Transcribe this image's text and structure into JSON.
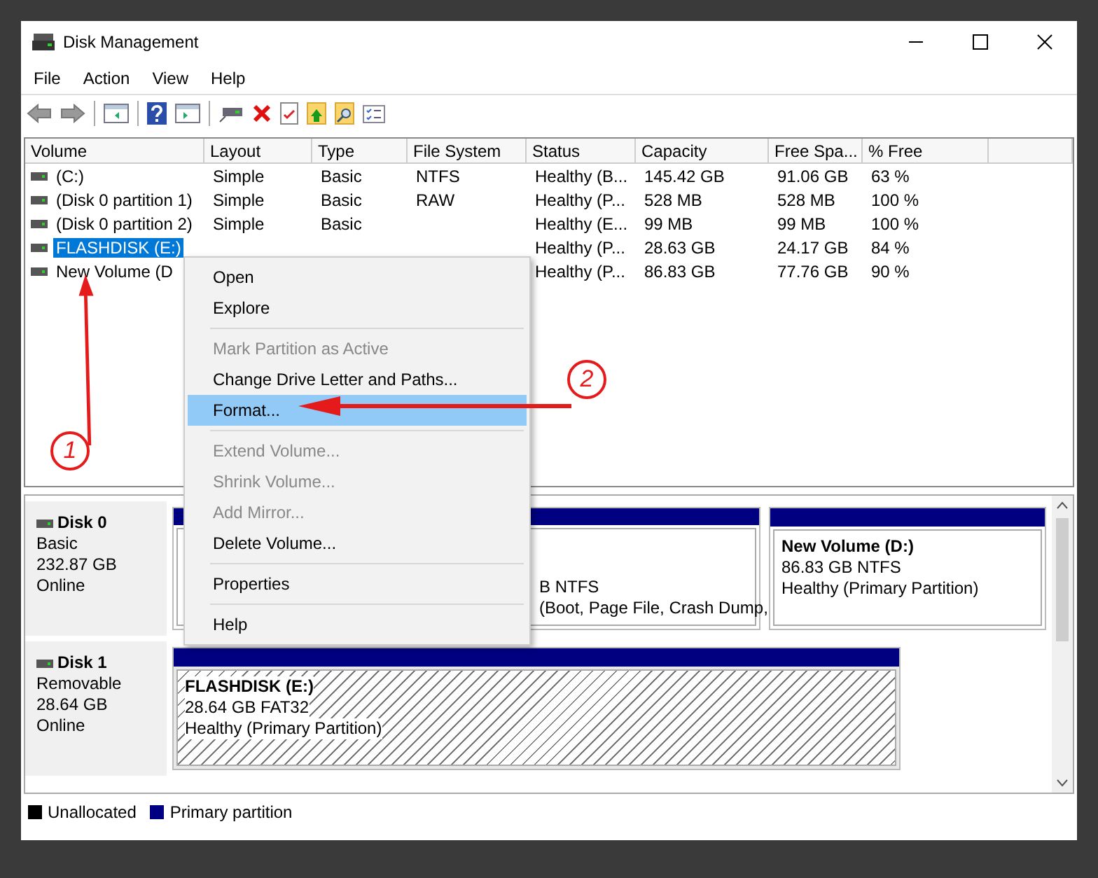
{
  "window": {
    "title": "Disk Management"
  },
  "menu_bar": [
    "File",
    "Action",
    "View",
    "Help"
  ],
  "table": {
    "columns": [
      "Volume",
      "Layout",
      "Type",
      "File System",
      "Status",
      "Capacity",
      "Free Spa...",
      "% Free"
    ],
    "rows": [
      {
        "selected": false,
        "cells": [
          "(C:)",
          "Simple",
          "Basic",
          "NTFS",
          "Healthy (B...",
          "145.42 GB",
          "91.06 GB",
          "63 %"
        ]
      },
      {
        "selected": false,
        "cells": [
          "(Disk 0 partition 1)",
          "Simple",
          "Basic",
          "RAW",
          "Healthy (P...",
          "528 MB",
          "528 MB",
          "100 %"
        ]
      },
      {
        "selected": false,
        "cells": [
          "(Disk 0 partition 2)",
          "Simple",
          "Basic",
          "",
          "Healthy (E...",
          "99 MB",
          "99 MB",
          "100 %"
        ]
      },
      {
        "selected": true,
        "cells": [
          "FLASHDISK (E:)",
          "",
          "",
          "",
          "Healthy (P...",
          "28.63 GB",
          "24.17 GB",
          "84 %"
        ]
      },
      {
        "selected": false,
        "cells": [
          "New Volume (D",
          "",
          "",
          "",
          "Healthy (P...",
          "86.83 GB",
          "77.76 GB",
          "90 %"
        ]
      }
    ]
  },
  "context_menu": {
    "items": [
      {
        "label": "Open",
        "disabled": false,
        "selected": false,
        "separator_after": false
      },
      {
        "label": "Explore",
        "disabled": false,
        "selected": false,
        "separator_after": true
      },
      {
        "label": "Mark Partition as Active",
        "disabled": true,
        "selected": false,
        "separator_after": false
      },
      {
        "label": "Change Drive Letter and Paths...",
        "disabled": false,
        "selected": false,
        "separator_after": false
      },
      {
        "label": "Format...",
        "disabled": false,
        "selected": true,
        "separator_after": true
      },
      {
        "label": "Extend Volume...",
        "disabled": true,
        "selected": false,
        "separator_after": false
      },
      {
        "label": "Shrink Volume...",
        "disabled": true,
        "selected": false,
        "separator_after": false
      },
      {
        "label": "Add Mirror...",
        "disabled": true,
        "selected": false,
        "separator_after": false
      },
      {
        "label": "Delete Volume...",
        "disabled": false,
        "selected": false,
        "separator_after": true
      },
      {
        "label": "Properties",
        "disabled": false,
        "selected": false,
        "separator_after": true
      },
      {
        "label": "Help",
        "disabled": false,
        "selected": false,
        "separator_after": false
      }
    ]
  },
  "disks": [
    {
      "name": "Disk 0",
      "type": "Basic",
      "size": "232.87 GB",
      "status": "Online",
      "partitions": [
        {
          "kind": "hidden",
          "size_fs": "B NTFS",
          "status": "(Boot, Page File, Crash Dump,"
        },
        {
          "kind": "plain",
          "title": "New Volume  (D:)",
          "size_fs": "86.83 GB NTFS",
          "status": "Healthy (Primary Partition)"
        }
      ]
    },
    {
      "name": "Disk 1",
      "type": "Removable",
      "size": "28.64 GB",
      "status": "Online",
      "partitions": [
        {
          "kind": "hatched",
          "title": "FLASHDISK  (E:)",
          "size_fs": "28.64 GB FAT32",
          "status": "Healthy (Primary Partition)"
        }
      ]
    }
  ],
  "legend": [
    {
      "label": "Unallocated",
      "color": "#000000"
    },
    {
      "label": "Primary partition",
      "color": "#000080"
    }
  ],
  "annotations": [
    {
      "number": "1"
    },
    {
      "number": "2"
    }
  ]
}
